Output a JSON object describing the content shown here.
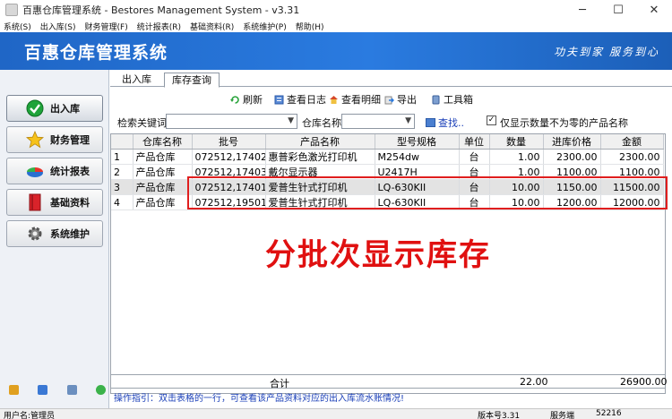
{
  "window": {
    "title": "百惠仓库管理系统 - Bestores Management System - v3.31",
    "minimize": "─",
    "maximize": "☐",
    "close": "✕"
  },
  "menu": [
    "系统(S)",
    "出入库(S)",
    "财务管理(F)",
    "统计报表(R)",
    "基础资料(R)",
    "系统维护(P)",
    "帮助(H)"
  ],
  "banner": {
    "title": "百惠仓库管理系统",
    "slogan": "功夫到家 服务到心"
  },
  "sidebar": {
    "items": [
      {
        "label": "出入库",
        "icon": "check-icon",
        "active": true
      },
      {
        "label": "财务管理",
        "icon": "star-icon",
        "active": false
      },
      {
        "label": "统计报表",
        "icon": "pie-chart-icon",
        "active": false
      },
      {
        "label": "基础资料",
        "icon": "book-icon",
        "active": false
      },
      {
        "label": "系统维护",
        "icon": "gear-icon",
        "active": false
      }
    ]
  },
  "tabs": [
    {
      "label": "出入库",
      "active": false
    },
    {
      "label": "库存查询",
      "active": true
    }
  ],
  "toolbar": {
    "refresh": "刷新",
    "view_log": "查看日志",
    "view_detail": "查看明细",
    "export": "导出",
    "toolbox": "工具箱"
  },
  "filter": {
    "keyword_label": "检索关键词",
    "keyword_value": "",
    "warehouse_label": "仓库名称",
    "warehouse_value": "",
    "search_label": "查找..",
    "nonzero_label": "仅显示数量不为零的产品名称",
    "nonzero_checked": "✓"
  },
  "table": {
    "columns": [
      "",
      "仓库名称",
      "批号",
      "产品名称",
      "型号规格",
      "单位",
      "数量",
      "进库价格",
      "金额"
    ],
    "rows": [
      [
        "1",
        "产品仓库",
        "072512,17402",
        "惠普彩色激光打印机",
        "M254dw",
        "台",
        "1.00",
        "2300.00",
        "2300.00"
      ],
      [
        "2",
        "产品仓库",
        "072512,17403",
        "戴尔显示器",
        "U2417H",
        "台",
        "1.00",
        "1100.00",
        "1100.00"
      ],
      [
        "3",
        "产品仓库",
        "072512,17401",
        "爱普生针式打印机",
        "LQ-630KII",
        "台",
        "10.00",
        "1150.00",
        "11500.00"
      ],
      [
        "4",
        "产品仓库",
        "072512,19501",
        "爱普生针式打印机",
        "LQ-630KII",
        "台",
        "10.00",
        "1200.00",
        "12000.00"
      ]
    ],
    "totals": {
      "label": "合计",
      "quantity": "22.00",
      "amount": "26900.00"
    }
  },
  "annotation": "分批次显示库存",
  "hint": "操作指引：双击表格的一行，可查看该产品资料对应的出入库流水账情况!",
  "status": {
    "user": "用户名:管理员",
    "version": "版本号3.31",
    "service": "服务端",
    "port": "52216"
  },
  "colors": {
    "banner": "#2a7be0",
    "highlight_border": "#e01e1e",
    "annotation": "#e01010",
    "hint": "#1a3fb8"
  }
}
